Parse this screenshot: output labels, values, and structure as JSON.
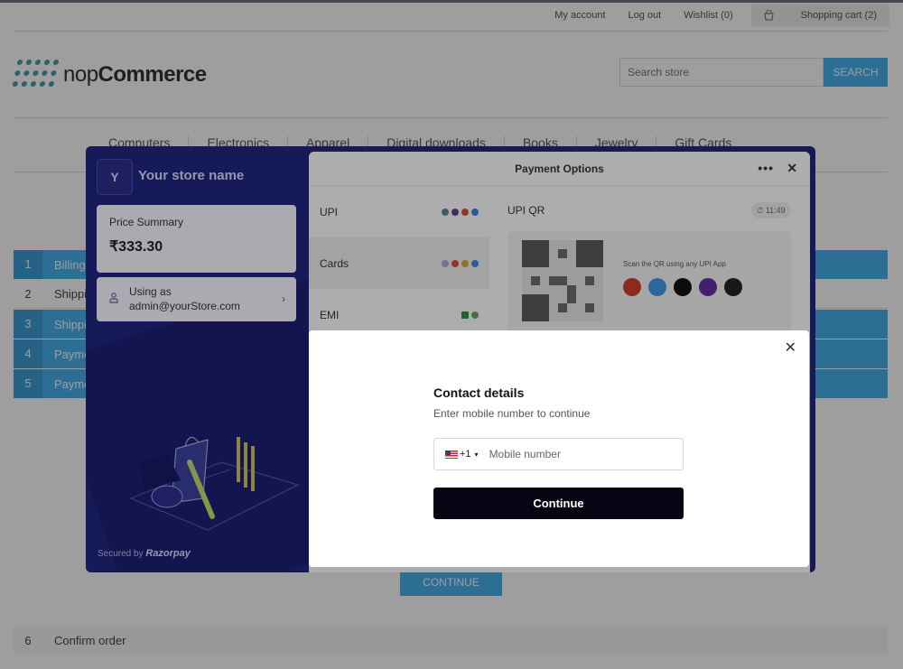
{
  "store": {
    "header_links": [
      "My account",
      "Log out",
      "Wishlist (0)"
    ],
    "cart_label": "Shopping cart (2)",
    "logo": {
      "prefix": "nop",
      "suffix": "Commerce"
    },
    "search": {
      "placeholder": "Search store",
      "button": "SEARCH"
    },
    "menu": [
      "Computers",
      "Electronics",
      "Apparel",
      "Digital downloads",
      "Books",
      "Jewelry",
      "Gift Cards"
    ],
    "steps": [
      {
        "num": "1",
        "label": "Billing"
      },
      {
        "num": "2",
        "label": "Shipping"
      },
      {
        "num": "3",
        "label": "Shipping"
      },
      {
        "num": "4",
        "label": "Payment"
      },
      {
        "num": "5",
        "label": "Payment"
      }
    ],
    "continue_label": "CONTINUE",
    "confirm_step": {
      "num": "6",
      "label": "Confirm order"
    }
  },
  "checkout": {
    "store_initial": "Y",
    "store_name": "Your store name",
    "price_summary_label": "Price Summary",
    "amount": "₹333.30",
    "using_as_label": "Using as",
    "user_email": "admin@yourStore.com",
    "secured_by": "Secured by",
    "provider": "Razorpay",
    "payment_options_title": "Payment Options",
    "methods": [
      "UPI",
      "Cards",
      "EMI"
    ],
    "upi_qr_label": "UPI QR",
    "timer": "11:49",
    "qr_hint": "Scan the QR using any UPI App"
  },
  "modal": {
    "title": "Contact details",
    "subtitle": "Enter mobile number to continue",
    "country_code": "+1",
    "phone_placeholder": "Mobile number",
    "continue_label": "Continue"
  },
  "colors": {
    "accent": "#4ab2f1",
    "razorpay_navy": "#22257a",
    "button_dark": "#050513"
  }
}
